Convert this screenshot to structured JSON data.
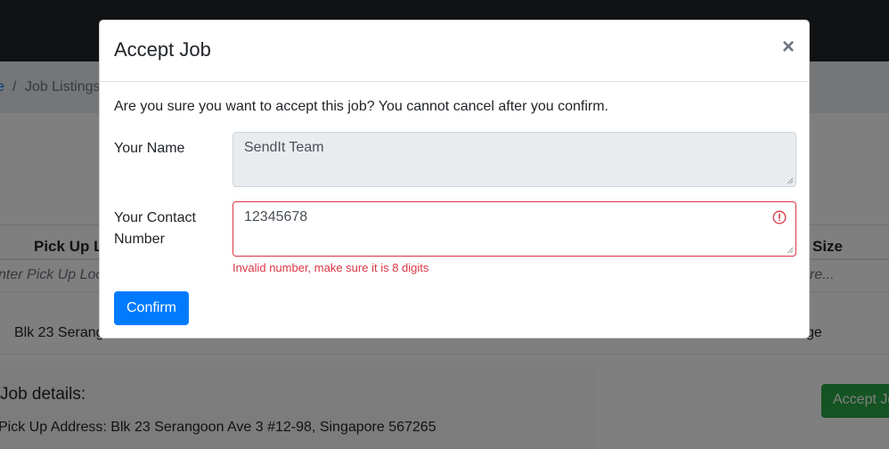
{
  "breadcrumb": {
    "home": "e",
    "separator": "/",
    "current": "Job Listings"
  },
  "table": {
    "headers": [
      "Pick Up L",
      "Size"
    ],
    "filter_placeholders": [
      "nter Pick Up Loc",
      "re..."
    ],
    "row": [
      "Blk 23 Serang",
      "ge"
    ]
  },
  "details": {
    "title": "Job details:",
    "pickup_line": "Pick Up Address: Blk 23 Serangoon Ave 3 #12-98, Singapore 567265"
  },
  "background_accept_button": "Accept Jo",
  "modal": {
    "title": "Accept Job",
    "close_symbol": "×",
    "message": "Are you sure you want to accept this job? You cannot cancel after you confirm.",
    "name_label": "Your Name",
    "name_value": "SendIt Team",
    "contact_label": "Your Contact Number",
    "contact_value": "12345678",
    "error_text": "Invalid number, make sure it is 8 digits",
    "confirm_label": "Confirm"
  },
  "colors": {
    "primary": "#007bff",
    "danger": "#dc3545",
    "success": "#28a745",
    "navbar": "#212529"
  },
  "icons": {
    "error": "exclamation-circle-icon",
    "close": "close-icon",
    "resize": "resize-grip-icon"
  }
}
